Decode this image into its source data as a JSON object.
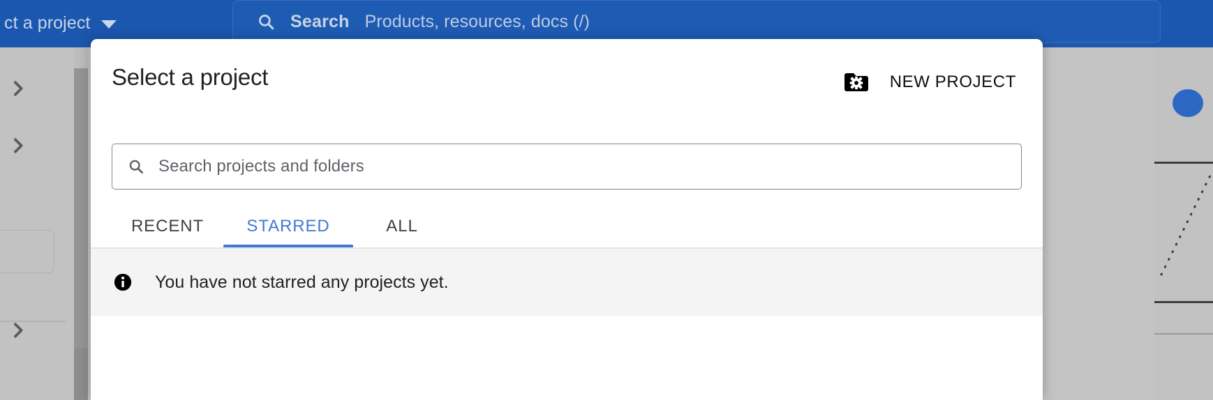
{
  "topbar": {
    "project_picker_label": "ct a project",
    "project_picker_icon": "chevron-down-icon",
    "search": {
      "icon": "search-icon",
      "label": "Search",
      "placeholder": "Products, resources, docs (/)"
    },
    "background_color": "#1b57ae"
  },
  "dialog": {
    "title": "Select a project",
    "folder_settings_icon": "folder-gear-icon",
    "new_project_label": "NEW PROJECT",
    "search": {
      "icon": "search-icon",
      "placeholder": "Search projects and folders",
      "value": ""
    },
    "tabs": [
      {
        "label": "RECENT",
        "active": false
      },
      {
        "label": "STARRED",
        "active": true
      },
      {
        "label": "ALL",
        "active": false
      }
    ],
    "empty_state": {
      "icon": "info-icon",
      "message": "You have not starred any projects yet."
    },
    "accent_color": "#4178d4"
  },
  "background": {
    "scrollbar": "vertical-scrollbar",
    "sidebar_chevrons": [
      "chevron-right-icon",
      "chevron-right-icon",
      "chevron-right-icon"
    ],
    "right_avatar": "blue-circle-node"
  }
}
